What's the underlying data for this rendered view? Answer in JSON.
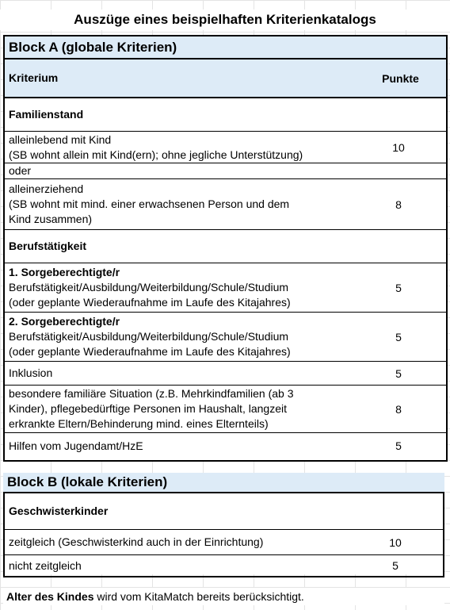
{
  "title": "Auszüge eines beispielhaften Kriterienkatalogs",
  "block_a": {
    "header": "Block A (globale Kriterien)",
    "col_criterion": "Kriterium",
    "col_points": "Punkte",
    "rows": [
      {
        "lines": [
          "Familienstand"
        ],
        "bold_first": true,
        "points": ""
      },
      {
        "lines": [
          "alleinlebend mit Kind",
          "(SB wohnt allein mit Kind(ern); ohne jegliche Unterstützung)"
        ],
        "bold_first": false,
        "points": "10"
      },
      {
        "lines": [
          "oder"
        ],
        "bold_first": false,
        "points": ""
      },
      {
        "lines": [
          "alleinerziehend",
          "(SB wohnt mit mind. einer erwachsenen Person und dem",
          "Kind zusammen)"
        ],
        "bold_first": false,
        "points": "8"
      },
      {
        "lines": [
          "Berufstätigkeit"
        ],
        "bold_first": true,
        "points": ""
      },
      {
        "lines": [
          "1. Sorgeberechtigte/r",
          "Berufstätigkeit/Ausbildung/Weiterbildung/Schule/Studium",
          "(oder geplante Wiederaufnahme im Laufe des Kitajahres)"
        ],
        "bold_first": true,
        "points": "5"
      },
      {
        "lines": [
          "2. Sorgeberechtigte/r",
          "Berufstätigkeit/Ausbildung/Weiterbildung/Schule/Studium",
          "(oder geplante Wiederaufnahme im Laufe des Kitajahres)"
        ],
        "bold_first": true,
        "points": "5"
      },
      {
        "lines": [
          "Inklusion"
        ],
        "bold_first": false,
        "points": "5"
      },
      {
        "lines": [
          "besondere familiäre Situation (z.B. Mehrkindfamilien (ab 3",
          "Kinder), pflegebedürftige Personen im Haushalt, langzeit",
          "erkrankte Eltern/Behinderung mind. eines Elternteils)"
        ],
        "bold_first": false,
        "points": "8"
      },
      {
        "lines": [
          "Hilfen vom Jugendamt/HzE"
        ],
        "bold_first": false,
        "points": "5"
      }
    ]
  },
  "block_b": {
    "header": "Block B (lokale Kriterien)",
    "rows": [
      {
        "lines": [
          "Geschwisterkinder"
        ],
        "bold_first": true,
        "points": ""
      },
      {
        "lines": [
          "zeitgleich (Geschwisterkind auch in der Einrichtung)"
        ],
        "bold_first": false,
        "points": "10"
      },
      {
        "lines": [
          "nicht zeitgleich"
        ],
        "bold_first": false,
        "points": "5"
      }
    ]
  },
  "footer": {
    "bold": "Alter des Kindes",
    "rest": " wird vom KitaMatch bereits berücksichtigt."
  }
}
